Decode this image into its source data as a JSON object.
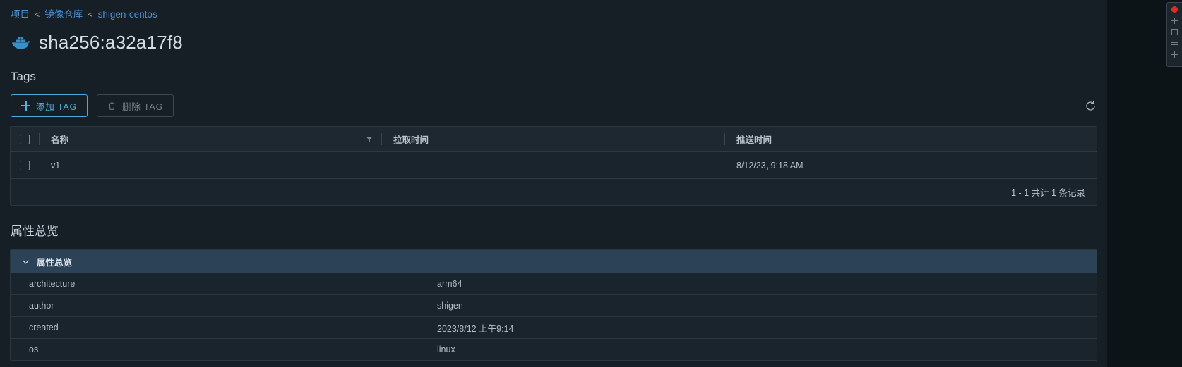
{
  "breadcrumb": {
    "items": [
      {
        "label": "项目"
      },
      {
        "label": "镜像仓库"
      },
      {
        "label": "shigen-centos"
      }
    ],
    "separator": "<"
  },
  "header": {
    "icon": "docker-whale-icon",
    "title": "sha256:a32a17f8"
  },
  "tags_section": {
    "heading": "Tags",
    "toolbar": {
      "add_tag_label": "添加 TAG",
      "delete_tag_label": "删除 TAG",
      "refresh_icon": "refresh-icon"
    },
    "table": {
      "columns": [
        {
          "key": "name",
          "label": "名称",
          "has_filter": true
        },
        {
          "key": "pull_time",
          "label": "拉取时间",
          "has_filter": false
        },
        {
          "key": "push_time",
          "label": "推送时间",
          "has_filter": false
        }
      ],
      "rows": [
        {
          "name": "v1",
          "pull_time": "",
          "push_time": "8/12/23, 9:18 AM",
          "selected": false
        }
      ],
      "pagination": "1 - 1 共计 1 条记录"
    }
  },
  "attributes_section": {
    "heading": "属性总览",
    "accordion": {
      "title": "属性总览",
      "expanded": true,
      "chevron_icon": "chevron-down-icon"
    },
    "rows": [
      {
        "key": "architecture",
        "value": "arm64"
      },
      {
        "key": "author",
        "value": "shigen"
      },
      {
        "key": "created",
        "value": "2023/8/12 上午9:14"
      },
      {
        "key": "os",
        "value": "linux"
      }
    ]
  },
  "side_panel": {
    "badge_color": "#e02a2a",
    "icons": [
      "notification-dot-icon",
      "plus-icon",
      "square-icon",
      "bars-icon",
      "plus-icon"
    ]
  },
  "colors": {
    "background": "#161f26",
    "accent": "#4fb3e0",
    "link": "#4f8fd6",
    "accordion_header": "#2c4257",
    "alert": "#e02a2a"
  }
}
